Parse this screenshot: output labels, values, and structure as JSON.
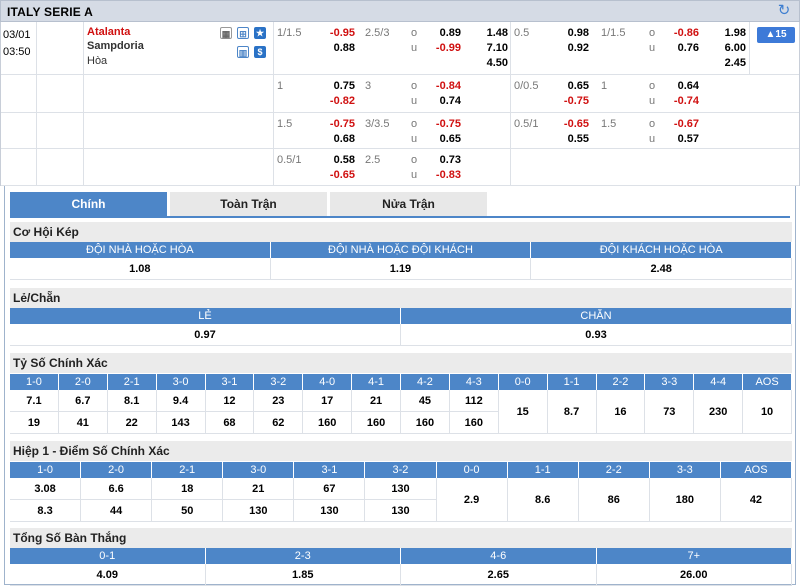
{
  "league": {
    "name": "ITALY SERIE A",
    "refresh_icon": "refresh-icon"
  },
  "match": {
    "date": "03/01",
    "time": "03:50",
    "home": "Atalanta",
    "away": "Sampdoria",
    "draw": "Hòa",
    "more_label": "▲15"
  },
  "odds_rows": [
    {
      "hdp_line": "1/1.5",
      "hdp_home": "-0.95",
      "hdp_away": "0.88",
      "ou_line": "2.5/3",
      "ou_o": "o",
      "ou_u": "u",
      "ou_over": "0.89",
      "ou_under": "-0.99",
      "x12_1": "1.48",
      "x12_2": "7.10",
      "x12_x": "4.50",
      "h1_hdp_line": "0.5",
      "h1_hdp_home": "0.98",
      "h1_hdp_away": "0.92",
      "h1_ou_line": "1/1.5",
      "h1_ou_o": "o",
      "h1_ou_u": "u",
      "h1_over": "-0.86",
      "h1_under": "0.76",
      "h1_1": "1.98",
      "h1_2": "6.00",
      "h1_x": "2.45"
    },
    {
      "hdp_line": "1",
      "hdp_home": "0.75",
      "hdp_away": "-0.82",
      "ou_line": "3",
      "ou_o": "o",
      "ou_u": "u",
      "ou_over": "-0.84",
      "ou_under": "0.74",
      "h1_hdp_line": "0/0.5",
      "h1_hdp_home": "0.65",
      "h1_hdp_away": "-0.75",
      "h1_ou_line": "1",
      "h1_ou_o": "o",
      "h1_ou_u": "u",
      "h1_over": "0.64",
      "h1_under": "-0.74"
    },
    {
      "hdp_line": "1.5",
      "hdp_home": "-0.75",
      "hdp_away": "0.68",
      "ou_line": "3/3.5",
      "ou_o": "o",
      "ou_u": "u",
      "ou_over": "-0.75",
      "ou_under": "0.65",
      "h1_hdp_line": "0.5/1",
      "h1_hdp_home": "-0.65",
      "h1_hdp_away": "0.55",
      "h1_ou_line": "1.5",
      "h1_ou_o": "o",
      "h1_ou_u": "u",
      "h1_over": "-0.67",
      "h1_under": "0.57"
    },
    {
      "hdp_line": "0.5/1",
      "hdp_home": "0.58",
      "hdp_away": "-0.65",
      "ou_line": "2.5",
      "ou_o": "o",
      "ou_u": "u",
      "ou_over": "0.73",
      "ou_under": "-0.83"
    }
  ],
  "tabs": [
    "Chính",
    "Toàn Trận",
    "Nửa Trận"
  ],
  "double_chance": {
    "title": "Cơ Hội Kép",
    "headers": [
      "ĐỘI NHÀ HOẶC HÒA",
      "ĐỘI NHÀ HOẶC ĐỘI KHÁCH",
      "ĐỘI KHÁCH HOẶC HÒA"
    ],
    "values": [
      "1.08",
      "1.19",
      "2.48"
    ]
  },
  "odd_even": {
    "title": "Lẻ/Chẵn",
    "headers": [
      "LẺ",
      "CHẴN"
    ],
    "values": [
      "0.97",
      "0.93"
    ]
  },
  "correct_score": {
    "title": "Tỷ Số Chính Xác",
    "win_headers": [
      "1-0",
      "2-0",
      "2-1",
      "3-0",
      "3-1",
      "3-2",
      "4-0",
      "4-1",
      "4-2",
      "4-3"
    ],
    "home": [
      "7.1",
      "6.7",
      "8.1",
      "9.4",
      "12",
      "23",
      "17",
      "21",
      "45",
      "112"
    ],
    "away": [
      "19",
      "41",
      "22",
      "143",
      "68",
      "62",
      "160",
      "160",
      "160",
      "160"
    ],
    "draw_headers": [
      "0-0",
      "1-1",
      "2-2",
      "3-3",
      "4-4",
      "AOS"
    ],
    "draw": [
      "15",
      "8.7",
      "16",
      "73",
      "230",
      "10"
    ]
  },
  "ht_correct_score": {
    "title": "Hiệp 1 - Điểm Số Chính Xác",
    "win_headers": [
      "1-0",
      "2-0",
      "2-1",
      "3-0",
      "3-1",
      "3-2"
    ],
    "home": [
      "3.08",
      "6.6",
      "18",
      "21",
      "67",
      "130"
    ],
    "away": [
      "8.3",
      "44",
      "50",
      "130",
      "130",
      "130"
    ],
    "draw_headers": [
      "0-0",
      "1-1",
      "2-2",
      "3-3",
      "AOS"
    ],
    "draw": [
      "2.9",
      "8.6",
      "86",
      "180",
      "42"
    ]
  },
  "total_goals": {
    "title": "Tổng Số Bàn Thắng",
    "headers": [
      "0-1",
      "2-3",
      "4-6",
      "7+"
    ],
    "values": [
      "4.09",
      "1.85",
      "2.65",
      "26.00"
    ]
  },
  "colors": {
    "header_blue": "#4d86c8",
    "odds_red": "#d01010",
    "bar_gray": "#d5dbe5"
  }
}
